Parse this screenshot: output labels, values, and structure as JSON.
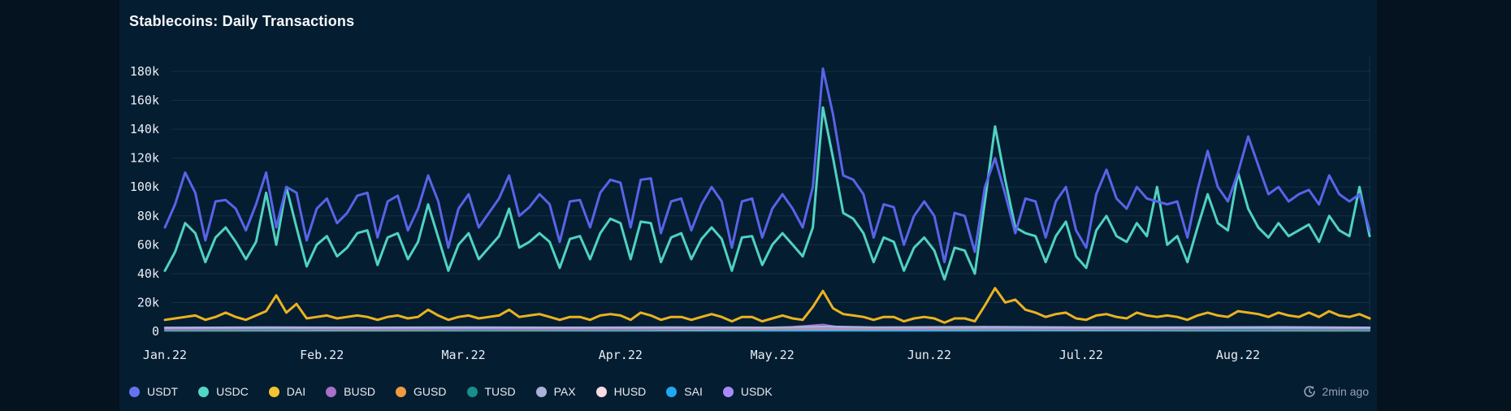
{
  "page": {
    "outer_background": "#04131f",
    "card_background": "#051d31",
    "grid_color": "rgba(120,170,205,0.14)"
  },
  "header": {
    "title": "Stablecoins: Daily Transactions"
  },
  "updated": {
    "label": "2min ago",
    "icon": "refresh-clock-icon",
    "color": "#97a2b4"
  },
  "legend": [
    {
      "label": "USDT",
      "color": "#6673f0"
    },
    {
      "label": "USDC",
      "color": "#52d7c6"
    },
    {
      "label": "DAI",
      "color": "#f5c332"
    },
    {
      "label": "BUSD",
      "color": "#a770c9"
    },
    {
      "label": "GUSD",
      "color": "#ef9b3f"
    },
    {
      "label": "TUSD",
      "color": "#178f8a"
    },
    {
      "label": "PAX",
      "color": "#a9b3d9"
    },
    {
      "label": "HUSD",
      "color": "#f9dbe5"
    },
    {
      "label": "SAI",
      "color": "#1fa9f2"
    },
    {
      "label": "USDK",
      "color": "#a78bfa"
    }
  ],
  "chart_data": {
    "type": "line",
    "title": "Stablecoins: Daily Transactions",
    "grid": "horizontal",
    "legend_position": "bottom",
    "x_axis": {
      "unit": "date (daily)",
      "start": "Jan 1, 2022",
      "end": "Aug 27, 2022",
      "tick_labels": [
        "Jan.22",
        "Feb.22",
        "Mar.22",
        "Apr.22",
        "May.22",
        "Jun.22",
        "Jul.22",
        "Aug.22"
      ],
      "tick_day_offsets": [
        0,
        31,
        59,
        90,
        120,
        151,
        181,
        212
      ],
      "domain_days": [
        0,
        238
      ]
    },
    "y_axis": {
      "unit": "transactions per day",
      "tick_labels": [
        "0",
        "20k",
        "40k",
        "60k",
        "80k",
        "100k",
        "120k",
        "140k",
        "160k",
        "180k"
      ],
      "tick_values_k": [
        0,
        20,
        40,
        60,
        80,
        100,
        120,
        140,
        160,
        180
      ],
      "range_k": [
        0,
        180
      ]
    },
    "values_unit": "thousands of transactions (k)",
    "sample_step_days": 2,
    "series": [
      {
        "name": "USDT",
        "color": "#5864e8",
        "width": 3,
        "values_k": [
          72,
          88,
          110,
          96,
          63,
          90,
          91,
          85,
          70,
          88,
          110,
          72,
          100,
          96,
          63,
          85,
          92,
          75,
          82,
          94,
          96,
          65,
          90,
          94,
          70,
          85,
          108,
          90,
          58,
          85,
          95,
          72,
          82,
          92,
          108,
          80,
          86,
          95,
          88,
          62,
          90,
          91,
          72,
          96,
          105,
          103,
          72,
          105,
          106,
          68,
          90,
          92,
          70,
          88,
          100,
          90,
          58,
          90,
          92,
          65,
          85,
          95,
          85,
          72,
          100,
          182,
          150,
          108,
          105,
          95,
          65,
          88,
          86,
          60,
          80,
          90,
          80,
          48,
          82,
          80,
          55,
          100,
          120,
          95,
          68,
          92,
          90,
          65,
          90,
          100,
          70,
          58,
          95,
          112,
          92,
          85,
          100,
          92,
          90,
          88,
          90,
          65,
          98,
          125,
          100,
          90,
          110,
          135,
          115,
          95,
          100,
          90,
          95,
          98,
          88,
          108,
          95,
          90,
          95,
          70
        ]
      },
      {
        "name": "USDC",
        "color": "#4fd2c2",
        "width": 3,
        "values_k": [
          42,
          55,
          75,
          68,
          48,
          65,
          72,
          62,
          50,
          62,
          96,
          60,
          100,
          72,
          45,
          60,
          66,
          52,
          58,
          68,
          70,
          46,
          65,
          68,
          50,
          62,
          88,
          65,
          42,
          60,
          68,
          50,
          58,
          66,
          85,
          58,
          62,
          68,
          62,
          44,
          64,
          66,
          50,
          68,
          78,
          75,
          50,
          76,
          75,
          48,
          65,
          68,
          50,
          64,
          72,
          64,
          42,
          65,
          66,
          46,
          60,
          68,
          60,
          52,
          72,
          155,
          120,
          82,
          78,
          68,
          48,
          65,
          62,
          42,
          58,
          65,
          56,
          36,
          58,
          56,
          40,
          90,
          142,
          105,
          72,
          68,
          66,
          48,
          66,
          76,
          52,
          44,
          70,
          80,
          66,
          62,
          75,
          66,
          100,
          60,
          66,
          48,
          72,
          95,
          75,
          70,
          110,
          85,
          72,
          65,
          75,
          66,
          70,
          74,
          62,
          80,
          70,
          66,
          100,
          66
        ]
      },
      {
        "name": "DAI",
        "color": "#e9b321",
        "width": 3,
        "values_k": [
          8,
          9,
          10,
          11,
          8,
          10,
          13,
          10,
          8,
          11,
          14,
          25,
          13,
          19,
          9,
          10,
          11,
          9,
          10,
          11,
          10,
          8,
          10,
          11,
          9,
          10,
          15,
          11,
          8,
          10,
          11,
          9,
          10,
          11,
          15,
          10,
          11,
          12,
          10,
          8,
          10,
          10,
          8,
          11,
          12,
          11,
          8,
          13,
          11,
          8,
          10,
          10,
          8,
          10,
          12,
          10,
          7,
          10,
          10,
          7,
          9,
          11,
          9,
          8,
          17,
          28,
          16,
          12,
          11,
          10,
          8,
          10,
          10,
          7,
          9,
          10,
          9,
          6,
          9,
          9,
          7,
          18,
          30,
          20,
          22,
          15,
          13,
          10,
          12,
          13,
          9,
          8,
          11,
          12,
          10,
          9,
          13,
          11,
          10,
          11,
          10,
          8,
          11,
          13,
          11,
          10,
          14,
          13,
          12,
          10,
          13,
          11,
          10,
          13,
          10,
          14,
          11,
          10,
          12,
          9
        ]
      },
      {
        "name": "HUSD",
        "color": "#f9dbe5",
        "width": 2,
        "points_day_k": [
          [
            0,
            1.0
          ],
          [
            40,
            1.1
          ],
          [
            80,
            1.0
          ],
          [
            120,
            1.1
          ],
          [
            160,
            1.0
          ],
          [
            200,
            1.0
          ],
          [
            238,
            0.9
          ]
        ]
      },
      {
        "name": "SAI",
        "color": "#1fa9f2",
        "width": 2,
        "points_day_k": [
          [
            0,
            0.4
          ],
          [
            60,
            0.5
          ],
          [
            120,
            0.4
          ],
          [
            180,
            0.5
          ],
          [
            238,
            0.4
          ]
        ]
      },
      {
        "name": "GUSD",
        "color": "#ef9b3f",
        "width": 2,
        "points_day_k": [
          [
            0,
            0.9
          ],
          [
            30,
            1.0
          ],
          [
            60,
            0.9
          ],
          [
            90,
            1.0
          ],
          [
            130,
            1.6
          ],
          [
            164,
            1.4
          ],
          [
            200,
            1.0
          ],
          [
            238,
            0.9
          ]
        ]
      },
      {
        "name": "TUSD",
        "color": "#178f8a",
        "width": 2,
        "points_day_k": [
          [
            0,
            1.3
          ],
          [
            30,
            1.5
          ],
          [
            60,
            1.3
          ],
          [
            90,
            1.4
          ],
          [
            130,
            2.2
          ],
          [
            164,
            1.9
          ],
          [
            200,
            1.4
          ],
          [
            238,
            1.3
          ]
        ]
      },
      {
        "name": "BUSD",
        "color": "#a470c8",
        "width": 2,
        "points_day_k": [
          [
            0,
            1.6
          ],
          [
            20,
            2.0
          ],
          [
            40,
            1.7
          ],
          [
            60,
            1.8
          ],
          [
            80,
            1.7
          ],
          [
            100,
            1.8
          ],
          [
            120,
            2.0
          ],
          [
            130,
            4.8
          ],
          [
            134,
            2.6
          ],
          [
            150,
            1.8
          ],
          [
            162,
            3.2
          ],
          [
            166,
            2.2
          ],
          [
            180,
            1.8
          ],
          [
            200,
            1.9
          ],
          [
            214,
            2.2
          ],
          [
            238,
            1.8
          ]
        ]
      },
      {
        "name": "USDK",
        "color": "#a78bfa",
        "width": 2,
        "points_day_k": [
          [
            0,
            2.1
          ],
          [
            30,
            2.2
          ],
          [
            60,
            2.1
          ],
          [
            90,
            2.2
          ],
          [
            120,
            2.1
          ],
          [
            150,
            2.2
          ],
          [
            180,
            2.1
          ],
          [
            210,
            2.2
          ],
          [
            238,
            2.1
          ]
        ]
      },
      {
        "name": "PAX",
        "color": "#a9b3d9",
        "width": 2.5,
        "points_day_k": [
          [
            0,
            2.6
          ],
          [
            20,
            2.8
          ],
          [
            40,
            2.7
          ],
          [
            60,
            2.8
          ],
          [
            80,
            2.7
          ],
          [
            100,
            2.8
          ],
          [
            120,
            2.7
          ],
          [
            130,
            3.4
          ],
          [
            140,
            2.8
          ],
          [
            164,
            3.1
          ],
          [
            180,
            2.8
          ],
          [
            200,
            2.8
          ],
          [
            220,
            2.9
          ],
          [
            238,
            2.7
          ]
        ]
      }
    ]
  }
}
